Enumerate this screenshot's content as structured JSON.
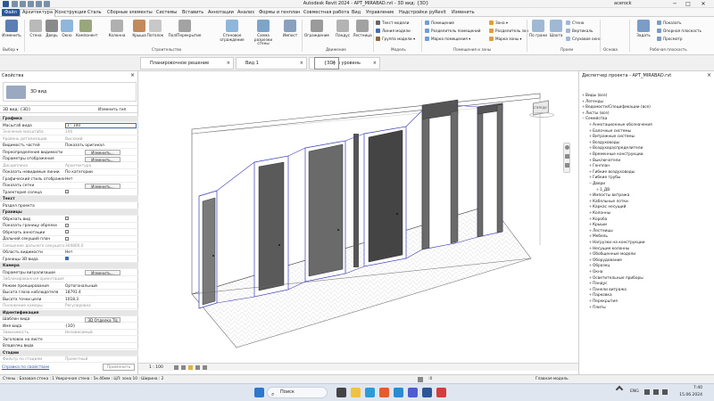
{
  "titlebar": {
    "title": "Autodesk Revit 2024 - APT_MIRABAD.rvt - 3D вид: {3D}",
    "user": "acerock",
    "minimize": "─",
    "maximize": "□",
    "close": "✕"
  },
  "tabs": [
    "Файл",
    "Архитектура",
    "Конструкция",
    "Сталь",
    "Сборные элементы",
    "Системы",
    "Вставить",
    "Аннотации",
    "Анализ",
    "Формы и генплан",
    "Совместная работа",
    "Вид",
    "Управление",
    "Надстройки",
    "pyRevit",
    "Изменить"
  ],
  "ribbon": {
    "select": {
      "modify": "Изменить",
      "panel": "Выбор ▾"
    },
    "build": {
      "buttons": [
        "Стена",
        "Дверь",
        "Окно",
        "Компонент",
        "Колонна",
        "Крыша",
        "Потолок",
        "Пол/Перекрытие",
        "Стеновое ограждение",
        "Схема разрезки стены",
        "Импост"
      ],
      "panel": "Строительство"
    },
    "circulation": {
      "buttons": [
        "Ограждение",
        "Пандус",
        "Лестница"
      ],
      "panel": "Движение"
    },
    "model": {
      "items": [
        "Текст модели",
        "Линия модели",
        "Группа модели ▾"
      ],
      "panel": "Модель"
    },
    "room": {
      "items": [
        "Помещение",
        "Разделитель помещений",
        "Марка помещения ▾",
        "Зона ▾",
        "Разделитель зон",
        "Марка зоны ▾"
      ],
      "panel": "Помещения и зоны"
    },
    "opening": {
      "items": [
        "По грани",
        "Шахта"
      ],
      "panel": ""
    },
    "datum": {
      "items": [
        "Стена",
        "Вертикаль",
        "Слуховое окно"
      ],
      "buttons": [
        "Уровень",
        "Сетка"
      ],
      "panel": "Проем"
    },
    "workplane": {
      "buttons": [
        "Задать"
      ],
      "items": [
        "Показать",
        "Опорная плоскость",
        "Просмотр"
      ],
      "panel": "Рабочая плоскость"
    },
    "extra_panels": [
      "Основа",
      "Окно"
    ]
  },
  "view_tabs": [
    {
      "label": "Планировочное решение",
      "close": "×"
    },
    {
      "label": "Вид 1",
      "close": "×"
    },
    {
      "label": "Опорный уровень",
      "close": "×"
    },
    {
      "label": "{3D}",
      "close": "×"
    }
  ],
  "properties": {
    "title": "Свойства",
    "close": "×",
    "type_name": "3D вид",
    "selector_value": "3D вид: {3D}",
    "edit_type": "Изменить тип",
    "rows": [
      {
        "k": "Графика",
        "hdr": true
      },
      {
        "k": "Масштаб вида",
        "v": "1 : 100"
      },
      {
        "k": "Значение масштаба",
        "v": "100",
        "dim": true
      },
      {
        "k": "Уровень детализации",
        "v": "Высокий",
        "dim": true
      },
      {
        "k": "Видимость частей",
        "v": "Показать оригинал"
      },
      {
        "k": "Переопределения видимости",
        "v": "Изменить...",
        "btn": true
      },
      {
        "k": "Параметры отображения",
        "v": "Изменить...",
        "btn": true
      },
      {
        "k": "Дисциплина",
        "v": "Архитектура",
        "dim": true
      },
      {
        "k": "Показать невидимые линии",
        "v": "По категории"
      },
      {
        "k": "Графический стиль отображения",
        "v": "Нет"
      },
      {
        "k": "Показать сетки",
        "v": "Изменить...",
        "btn": true
      },
      {
        "k": "Траектория солнца",
        "cb": false
      },
      {
        "k": "Текст",
        "hdr": true
      },
      {
        "k": "Раздел проекта",
        "v": ""
      },
      {
        "k": "Границы",
        "hdr": true
      },
      {
        "k": "Обрезать вид",
        "cb": false
      },
      {
        "k": "Показать границу обрезки",
        "cb": false
      },
      {
        "k": "Обрезать аннотации",
        "cb": false
      },
      {
        "k": "Дальний секущий план",
        "cb": false
      },
      {
        "k": "Смещение дальнего секущего",
        "v": "304800.0",
        "dim": true
      },
      {
        "k": "Область видимости",
        "v": "Нет"
      },
      {
        "k": "Границы 3D вида",
        "cb": true
      },
      {
        "k": "Камера",
        "hdr": true
      },
      {
        "k": "Параметры визуализации",
        "v": "Изменить...",
        "btn": true
      },
      {
        "k": "Заблокированная ориентация",
        "v": "",
        "dim": true
      },
      {
        "k": "Режим проецирования",
        "v": "Ортогональный"
      },
      {
        "k": "Высота глаза наблюдателя",
        "v": "18791.4"
      },
      {
        "k": "Высота точки цели",
        "v": "1018.3"
      },
      {
        "k": "Положение камеры",
        "v": "Регулировка",
        "dim": true
      },
      {
        "k": "Идентификация",
        "hdr": true
      },
      {
        "k": "Шаблон вида",
        "v": "3D Отделка ТЦ",
        "btn": true
      },
      {
        "k": "Имя вида",
        "v": "{3D}"
      },
      {
        "k": "Зависимость",
        "v": "Независимый",
        "dim": true
      },
      {
        "k": "Заголовок на листе",
        "v": ""
      },
      {
        "k": "Владелец вида",
        "v": ""
      },
      {
        "k": "Стадии",
        "hdr": true
      },
      {
        "k": "Фильтр по стадиям",
        "v": "Проектный",
        "dim": true
      }
    ],
    "help_link": "Справка по свойствам",
    "apply": "Применить"
  },
  "canvas": {
    "scale_label": "1 : 100",
    "viewcube_label": "СПЕРЕДИ",
    "status_right": "Главная модель"
  },
  "browser": {
    "title": "Диспетчер проекта - APT_MIRABAD.rvt",
    "close": "×",
    "items": [
      {
        "t": "Виды (все)",
        "lvl": 0,
        "exp": "+"
      },
      {
        "t": "Легенды",
        "lvl": 0,
        "exp": "+"
      },
      {
        "t": "Ведомости/Спецификации (все)",
        "lvl": 0,
        "exp": "+"
      },
      {
        "t": "Листы (все)",
        "lvl": 0,
        "exp": "+"
      },
      {
        "t": "Семейства",
        "lvl": 0,
        "exp": "−"
      },
      {
        "t": "Аннотационные обозначения",
        "lvl": 1,
        "exp": "+"
      },
      {
        "t": "Балочные системы",
        "lvl": 1,
        "exp": "+"
      },
      {
        "t": "Витражные системы",
        "lvl": 1,
        "exp": "+"
      },
      {
        "t": "Воздуховоды",
        "lvl": 1,
        "exp": "+"
      },
      {
        "t": "Воздухораспределители",
        "lvl": 1,
        "exp": "+"
      },
      {
        "t": "Временные конструкции",
        "lvl": 1,
        "exp": "+"
      },
      {
        "t": "Выключатели",
        "lvl": 1,
        "exp": "+"
      },
      {
        "t": "Генплан",
        "lvl": 1,
        "exp": "+"
      },
      {
        "t": "Гибкие воздуховоды",
        "lvl": 1,
        "exp": "+"
      },
      {
        "t": "Гибкие трубы",
        "lvl": 1,
        "exp": "+"
      },
      {
        "t": "Двери",
        "lvl": 1,
        "exp": "−"
      },
      {
        "t": "1_ДВ",
        "lvl": 2,
        "exp": "+"
      },
      {
        "t": "Импосты витража",
        "lvl": 1,
        "exp": "+"
      },
      {
        "t": "Кабельные лотки",
        "lvl": 1,
        "exp": "+"
      },
      {
        "t": "Каркас несущий",
        "lvl": 1,
        "exp": "+"
      },
      {
        "t": "Колонны",
        "lvl": 1,
        "exp": "+"
      },
      {
        "t": "Короба",
        "lvl": 1,
        "exp": "+"
      },
      {
        "t": "Крыши",
        "lvl": 1,
        "exp": "+"
      },
      {
        "t": "Лестницы",
        "lvl": 1,
        "exp": "+"
      },
      {
        "t": "Мебель",
        "lvl": 1,
        "exp": "+"
      },
      {
        "t": "Нагрузки на конструкции",
        "lvl": 1,
        "exp": "+"
      },
      {
        "t": "Несущие колонны",
        "lvl": 1,
        "exp": "+"
      },
      {
        "t": "Обобщенные модели",
        "lvl": 1,
        "exp": "+"
      },
      {
        "t": "Оборудование",
        "lvl": 1,
        "exp": "+"
      },
      {
        "t": "Образец",
        "lvl": 1,
        "exp": "+"
      },
      {
        "t": "Окна",
        "lvl": 1,
        "exp": "+"
      },
      {
        "t": "Осветительные приборы",
        "lvl": 1,
        "exp": "+"
      },
      {
        "t": "Пандус",
        "lvl": 1,
        "exp": "+"
      },
      {
        "t": "Панели витража",
        "lvl": 1,
        "exp": "+"
      },
      {
        "t": "Парковка",
        "lvl": 1,
        "exp": "+"
      },
      {
        "t": "Перекрытия",
        "lvl": 1,
        "exp": "+"
      },
      {
        "t": "Плиты",
        "lvl": 1,
        "exp": "+"
      }
    ]
  },
  "statusbar": {
    "text": "Стены : Базовая стена : 1 Уверочная стена : 5к.46мм : ЦЛ: зона 10 : Ширина : 2",
    "right": ":0"
  },
  "taskbar": {
    "search": "Поиск",
    "lang": "ENG",
    "time": "7:40",
    "date": "15.06.2024"
  }
}
